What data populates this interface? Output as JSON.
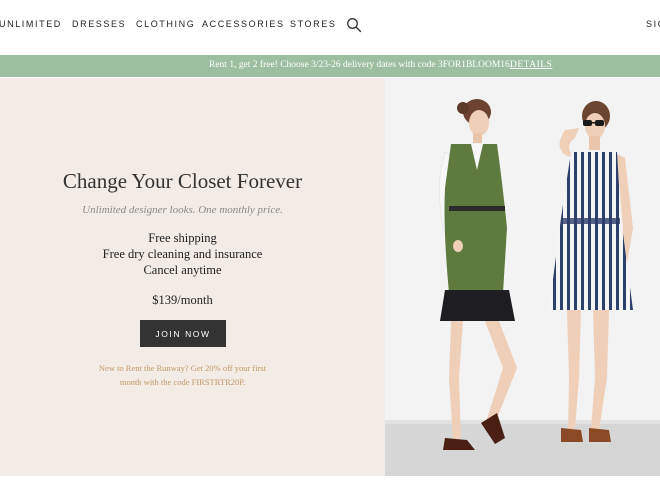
{
  "nav": {
    "items": [
      "UNLIMITED",
      "DRESSES",
      "CLOTHING",
      "ACCESSORIES",
      "STORES"
    ],
    "search_icon": "search-icon",
    "sign_in": "SIG"
  },
  "promo": {
    "text": "Rent 1, get 2 free! Choose 3/23-26 delivery dates with code 3FOR1BLOOM16.",
    "link": "DETAILS"
  },
  "hero": {
    "headline": "Change Your Closet Forever",
    "subhead": "Unlimited designer looks. One monthly price.",
    "benefits": [
      "Free shipping",
      "Free dry cleaning and insurance",
      "Cancel anytime"
    ],
    "price": "$139/month",
    "cta": "JOIN NOW",
    "offer_line1": "New to Rent the Runway? Get 20% off your first",
    "offer_line2": "month with the code FIRSTRTR20P."
  },
  "colors": {
    "promo_bg": "#9cbfa0",
    "hero_bg": "#f2ebe6",
    "button_bg": "#333333",
    "offer_text": "#c29a66"
  }
}
